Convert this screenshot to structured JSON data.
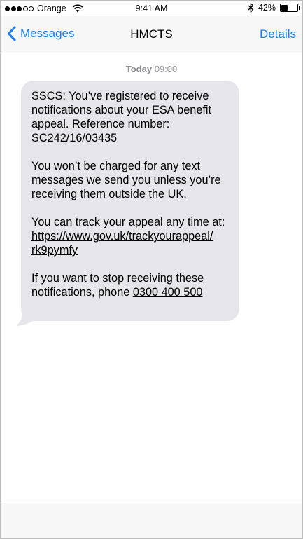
{
  "status_bar": {
    "carrier": "Orange",
    "time": "9:41 AM",
    "battery_text": "42%",
    "battery_level": 0.42,
    "signal_bars_filled": 3,
    "signal_bars_total": 5
  },
  "nav": {
    "back_label": "Messages",
    "title": "HMCTS",
    "details_label": "Details"
  },
  "conversation": {
    "day": "Today",
    "time": "09:00",
    "message": {
      "p1": "SSCS: You’ve registered to receive notifications about your ESA benefit appeal. Reference number: SC242/16/03435",
      "p2": "You won’t be charged for any text messages we send you unless you’re receiving them outside the UK.",
      "p3_text": "You can track your appeal any time at: ",
      "p3_link_line1": "https://www.gov.uk/trackyourappeal/",
      "p3_link_line2": "rk9pymfy",
      "p4_text": "If you want to stop receiving these notifications, phone ",
      "p4_phone": "0300 400 500"
    }
  },
  "colors": {
    "accent": "#1a7ff5",
    "bubble": "#e5e5ea",
    "timestamp": "#8e8e93"
  }
}
